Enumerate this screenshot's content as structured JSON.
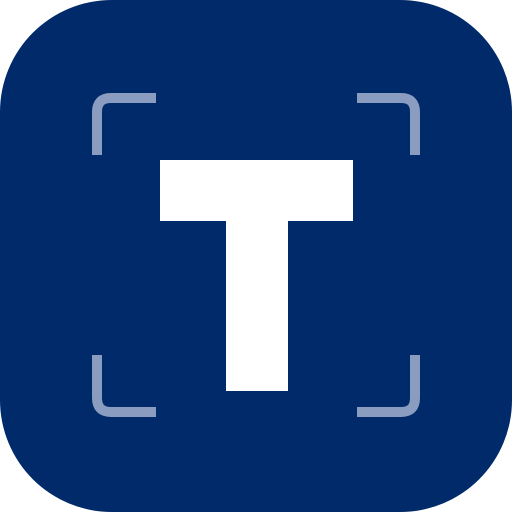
{
  "app_icon": {
    "name": "text-scanner-app-icon",
    "glyph_icon": "letter-t-icon",
    "frame_icon": "scan-frame-corners-icon",
    "colors": {
      "background": "#002a6a",
      "glyph": "#ffffff",
      "frame": "#8a9cc0"
    }
  }
}
